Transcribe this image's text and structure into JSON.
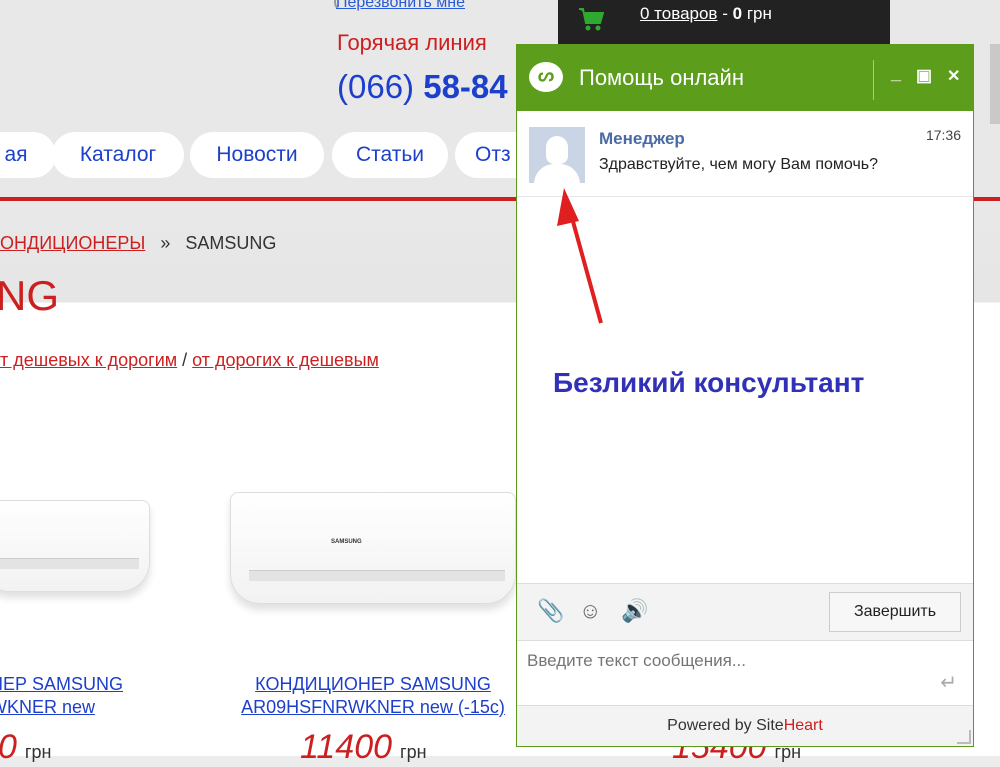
{
  "header": {
    "callback_label": "Перезвонить мне",
    "hotline_label": "Горячая линия",
    "phone_code": "(066)",
    "phone_number": "58-84",
    "cart": {
      "items_label": "0 товаров",
      "dash": "-",
      "sum": "0",
      "currency": "грн"
    }
  },
  "nav": {
    "items": [
      "ая",
      "Каталог",
      "Новости",
      "Статьи",
      "Отз"
    ]
  },
  "breadcrumb": {
    "parent": "ОНДИЦИОНЕРЫ",
    "sep": "»",
    "current": "SAMSUNG"
  },
  "brand_heading": "NG",
  "sort": {
    "cheap_first": "т дешевых к дорогим",
    "sep": "/",
    "expensive_first": "от дорогих к дешевым"
  },
  "products": [
    {
      "name_line1": "НЕР SAMSUNG",
      "name_line2": "WKNER new",
      "price": "0",
      "currency": "грн",
      "ac_logo": ""
    },
    {
      "name_line1": "КОНДИЦИОНЕР SAMSUNG",
      "name_line2": "AR09HSFNRWKNER new (-15c)",
      "price": "11400",
      "currency": "грн",
      "ac_logo": "SAMSUNG"
    },
    {
      "price": "15400",
      "currency": "грн"
    }
  ],
  "chat": {
    "title": "Помощь онлайн",
    "controls": {
      "minimize": "_",
      "maximize": "▣",
      "close": "✕"
    },
    "message": {
      "author": "Менеджер",
      "time": "17:36",
      "text": "Здравствуйте, чем могу Вам помочь?"
    },
    "annotation": "Безликий консультант",
    "annotation_color": "#3030b8",
    "arrow_color": "#e02020",
    "toolbar": {
      "attach": "attach-icon",
      "emoji": "smile-icon",
      "sound": "speaker-icon",
      "finish_label": "Завершить"
    },
    "input": {
      "placeholder": "Введите текст сообщения...",
      "value": ""
    },
    "footer": {
      "powered": "Powered by",
      "brand_a": "Site",
      "brand_b": "Heart"
    },
    "accent": "#5c9d1c"
  }
}
